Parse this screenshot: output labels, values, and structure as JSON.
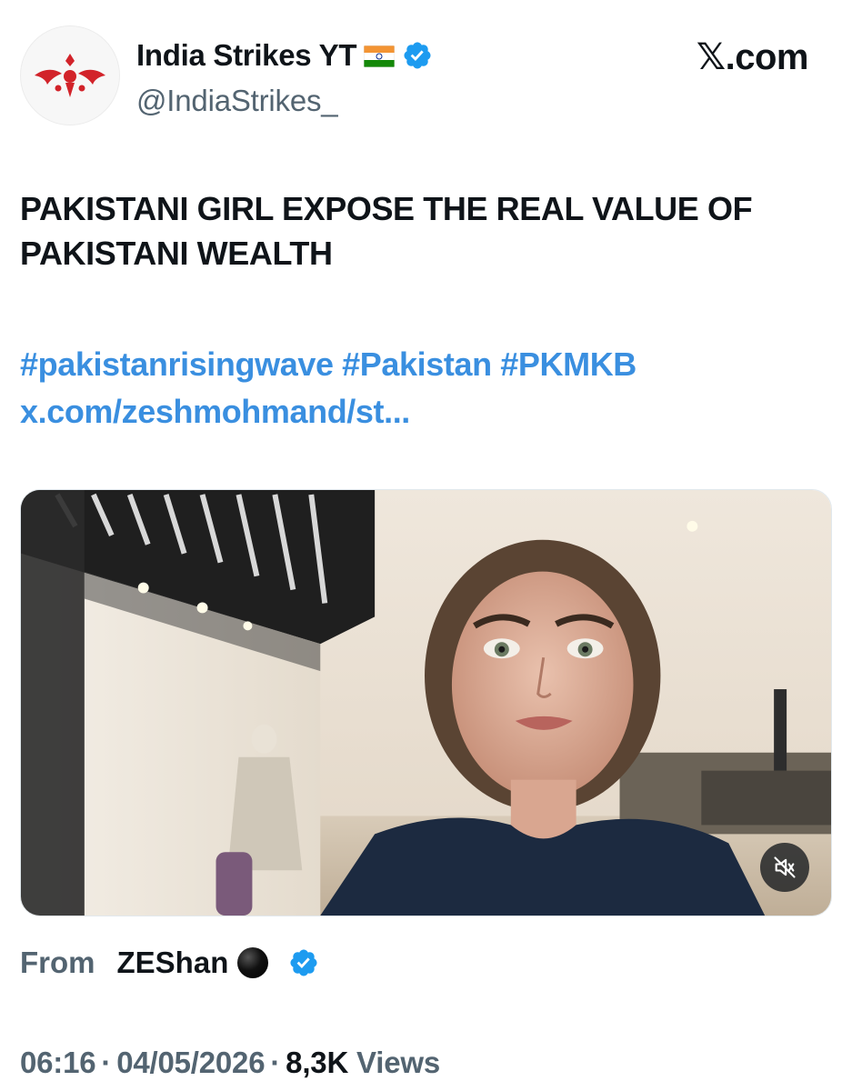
{
  "author": {
    "display_name": "India Strikes YT",
    "handle": "@IndiaStrikes_",
    "flag": "india-flag-icon",
    "verified": true
  },
  "site_label": "𝕏.com",
  "tweet": {
    "text": "PAKISTANI GIRL EXPOSE THE REAL VALUE OF PAKISTANI WEALTH",
    "hashtags": [
      "#pakistanrisingwave",
      "#Pakistan",
      "#PKMKB"
    ],
    "link": "x.com/zeshmohmand/st..."
  },
  "video": {
    "muted": true,
    "mute_icon": "speaker-muted-icon"
  },
  "source": {
    "label": "From",
    "name": "ZEShan",
    "emoji": "black-circle-icon",
    "verified": true
  },
  "meta": {
    "time": "06:16",
    "date": "04/05/2026",
    "views_count": "8,3K",
    "views_label": "Views"
  },
  "colors": {
    "link": "#3a8fe0",
    "verified": "#1d9bf0",
    "muted_text": "#536471"
  }
}
